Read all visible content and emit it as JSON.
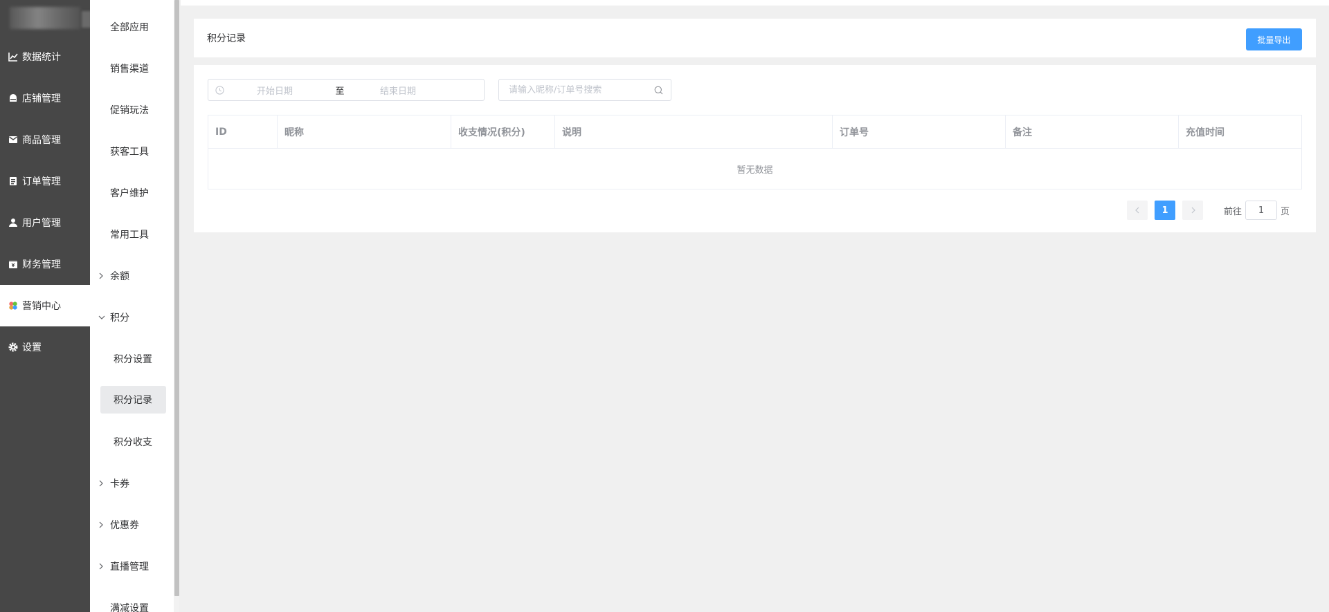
{
  "sidebar": {
    "items": [
      {
        "label": "数据统计",
        "icon": "chart-line-icon"
      },
      {
        "label": "店铺管理",
        "icon": "shop-icon"
      },
      {
        "label": "商品管理",
        "icon": "goods-icon"
      },
      {
        "label": "订单管理",
        "icon": "order-icon"
      },
      {
        "label": "用户管理",
        "icon": "user-icon"
      },
      {
        "label": "财务管理",
        "icon": "finance-icon"
      },
      {
        "label": "营销中心",
        "icon": "marketing-icon",
        "active": true
      },
      {
        "label": "设置",
        "icon": "gear-icon"
      }
    ]
  },
  "submenu": {
    "items": [
      {
        "label": "全部应用"
      },
      {
        "label": "销售渠道"
      },
      {
        "label": "促销玩法"
      },
      {
        "label": "获客工具"
      },
      {
        "label": "客户维护"
      },
      {
        "label": "常用工具"
      },
      {
        "label": "余额",
        "expandable": true,
        "expanded": false
      },
      {
        "label": "积分",
        "expandable": true,
        "expanded": true
      },
      {
        "label": "积分设置",
        "child": true
      },
      {
        "label": "积分记录",
        "child": true,
        "active": true
      },
      {
        "label": "积分收支",
        "child": true
      },
      {
        "label": "卡券",
        "expandable": true,
        "expanded": false
      },
      {
        "label": "优惠券",
        "expandable": true,
        "expanded": false
      },
      {
        "label": "直播管理",
        "expandable": true,
        "expanded": false
      },
      {
        "label": "满减设置"
      }
    ]
  },
  "header": {
    "title": "积分记录",
    "export_button": "批量导出"
  },
  "filters": {
    "start_placeholder": "开始日期",
    "range_separator": "至",
    "end_placeholder": "结束日期",
    "search_placeholder": "请输入昵称/订单号搜索"
  },
  "table": {
    "columns": [
      "ID",
      "昵称",
      "收支情况(积分)",
      "说明",
      "订单号",
      "备注",
      "充值时间"
    ],
    "empty_text": "暂无数据"
  },
  "pagination": {
    "current_page": "1",
    "goto_prefix": "前往",
    "goto_value": "1",
    "goto_suffix": "页"
  },
  "colors": {
    "sidebar_bg": "#474747",
    "primary": "#409eff",
    "page_bg": "#f0f0f0"
  }
}
